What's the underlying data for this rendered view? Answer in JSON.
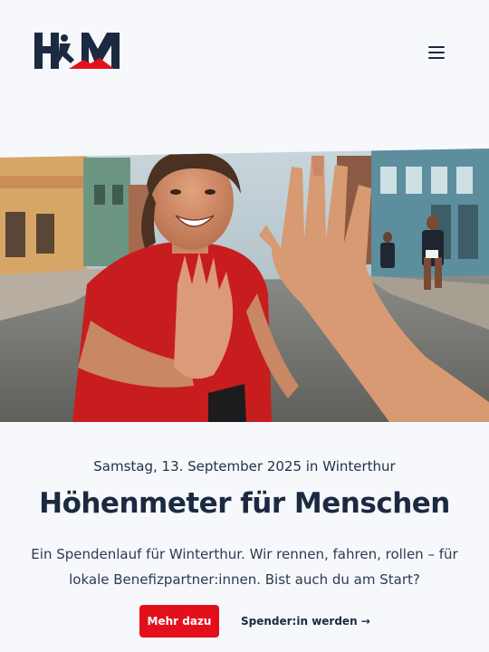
{
  "header": {
    "logo_text": "HFM",
    "menu_icon": "hamburger-menu-icon"
  },
  "hero": {
    "image_alt": ""
  },
  "event": {
    "date_line": "Samstag, 13. September 2025 in Winterthur",
    "title": "Höhenmeter für Menschen",
    "lead_line1": "Ein Spendenlauf für Winterthur. Wir rennen, fahren, rollen – für",
    "lead_line2": "lokale Benefizpartner:innen. Bist auch du am Start?"
  },
  "actions": {
    "primary_label": "Mehr dazu",
    "secondary_label": "Spender:in werden →"
  },
  "colors": {
    "navy": "#1b2a40",
    "accent_red": "#e3101b",
    "background": "#f6f8fb"
  }
}
